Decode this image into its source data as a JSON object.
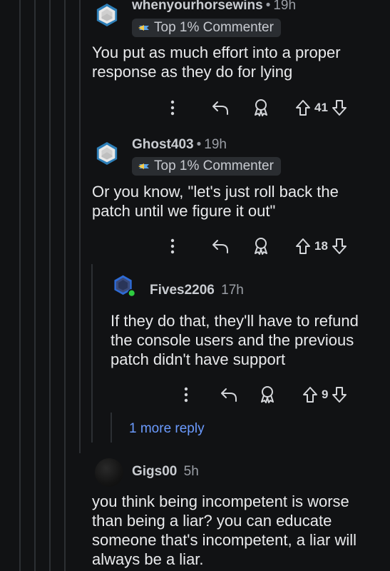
{
  "comments": [
    {
      "username": "whenyourhorsewins",
      "separator": "•",
      "time": "19h",
      "flair": "Top 1% Commenter",
      "body": "You put as much effort into a proper response as they do for lying",
      "votes": "41",
      "avatar_color": "#2e7fb8"
    },
    {
      "username": "Ghost403",
      "separator": "•",
      "time": "19h",
      "flair": "Top 1% Commenter",
      "body": "Or you know, \"let's just roll back the patch until we figure it out\"",
      "votes": "18",
      "avatar_color": "#2e7fb8"
    },
    {
      "username": "Fives2206",
      "time": "17h",
      "body": "If they do that, they'll have to refund the console users and the previous patch didn't have support",
      "votes": "9",
      "avatar_color": "#2e6bd6",
      "online_color": "#2ecc40"
    },
    {
      "username": "Gigs00",
      "time": "5h",
      "body": "you think being incompetent is worse than being a liar? you can educate someone that's incompetent, a liar will always be a liar."
    }
  ],
  "more_reply": "1 more reply",
  "icons": {
    "more": "more-vertical-icon",
    "reply": "reply-arrow-icon",
    "award": "award-icon",
    "upvote": "upvote-arrow-icon",
    "downvote": "downvote-arrow-icon"
  },
  "colors": {
    "background": "#111214",
    "link": "#6b9bff",
    "thread_line": "#2c2f33"
  }
}
